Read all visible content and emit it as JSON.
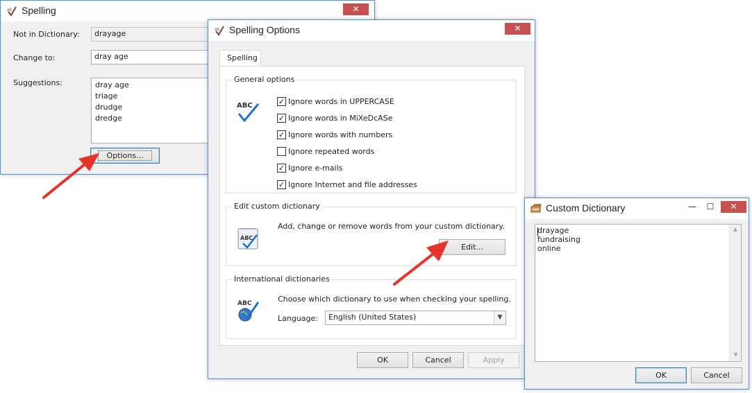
{
  "spelling": {
    "title": "Spelling",
    "not_in_dictionary_label": "Not in Dictionary:",
    "not_in_dictionary_value": "drayage",
    "change_to_label": "Change to:",
    "change_to_value": "dray age",
    "suggestions_label": "Suggestions:",
    "suggestions": [
      "dray age",
      "triage",
      "drudge",
      "dredge"
    ],
    "options_button": "Options..."
  },
  "spelling_options": {
    "title": "Spelling Options",
    "tab_label": "Spelling",
    "general_options_title": "General options",
    "checkboxes": [
      {
        "label": "Ignore words in UPPERCASE",
        "checked": true
      },
      {
        "label": "Ignore words in MiXeDcASe",
        "checked": true
      },
      {
        "label": "Ignore words with numbers",
        "checked": true
      },
      {
        "label": "Ignore repeated words",
        "checked": false
      },
      {
        "label": "Ignore e-mails",
        "checked": true
      },
      {
        "label": "Ignore Internet and file addresses",
        "checked": true
      }
    ],
    "custom_dict_title": "Edit custom dictionary",
    "custom_dict_text": "Add, change or remove words from your custom dictionary.",
    "edit_button": "Edit...",
    "intl_title": "International dictionaries",
    "intl_text": "Choose which dictionary to use when checking your spelling.",
    "language_label": "Language:",
    "language_value": "English (United States)",
    "ok_button": "OK",
    "cancel_button": "Cancel",
    "apply_button": "Apply"
  },
  "custom_dictionary": {
    "title": "Custom Dictionary",
    "words": [
      "drayage",
      "fundraising",
      "online"
    ],
    "ok_button": "OK",
    "cancel_button": "Cancel"
  },
  "abc_icon_text": "ABC",
  "colors": {
    "close": "#c75050",
    "arrow": "#e53329",
    "window_border": "#4e8fd6",
    "check_blue": "#1f6fd1"
  },
  "icons": {
    "close": "close-icon",
    "minimize": "minimize-icon",
    "maximize": "maximize-icon",
    "dropdown": "chevron-down-icon"
  }
}
